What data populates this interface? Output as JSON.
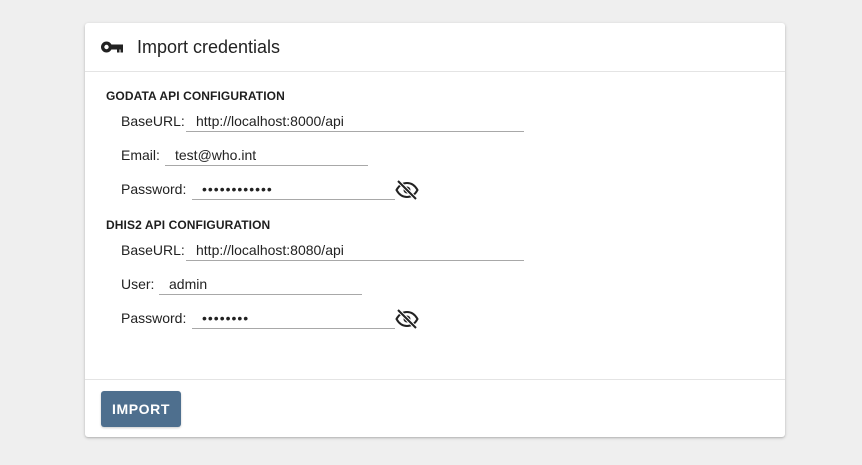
{
  "header": {
    "icon": "key-icon",
    "title": "Import credentials"
  },
  "godata": {
    "section_title": "GODATA API CONFIGURATION",
    "baseurl_label": "BaseURL:",
    "baseurl_value": "http://localhost:8000/api",
    "email_label": "Email:",
    "email_value": "test@who.int",
    "password_label": "Password:",
    "password_value": "••••••••••••",
    "password_toggle_icon": "eye-off-icon"
  },
  "dhis2": {
    "section_title": "DHIS2 API CONFIGURATION",
    "baseurl_label": "BaseURL:",
    "baseurl_value": "http://localhost:8080/api",
    "user_label": "User:",
    "user_value": "admin",
    "password_label": "Password:",
    "password_value": "••••••••",
    "password_toggle_icon": "eye-off-icon"
  },
  "footer": {
    "import_label": "IMPORT"
  },
  "colors": {
    "button": "#4e6f8e",
    "background": "#efefef"
  }
}
